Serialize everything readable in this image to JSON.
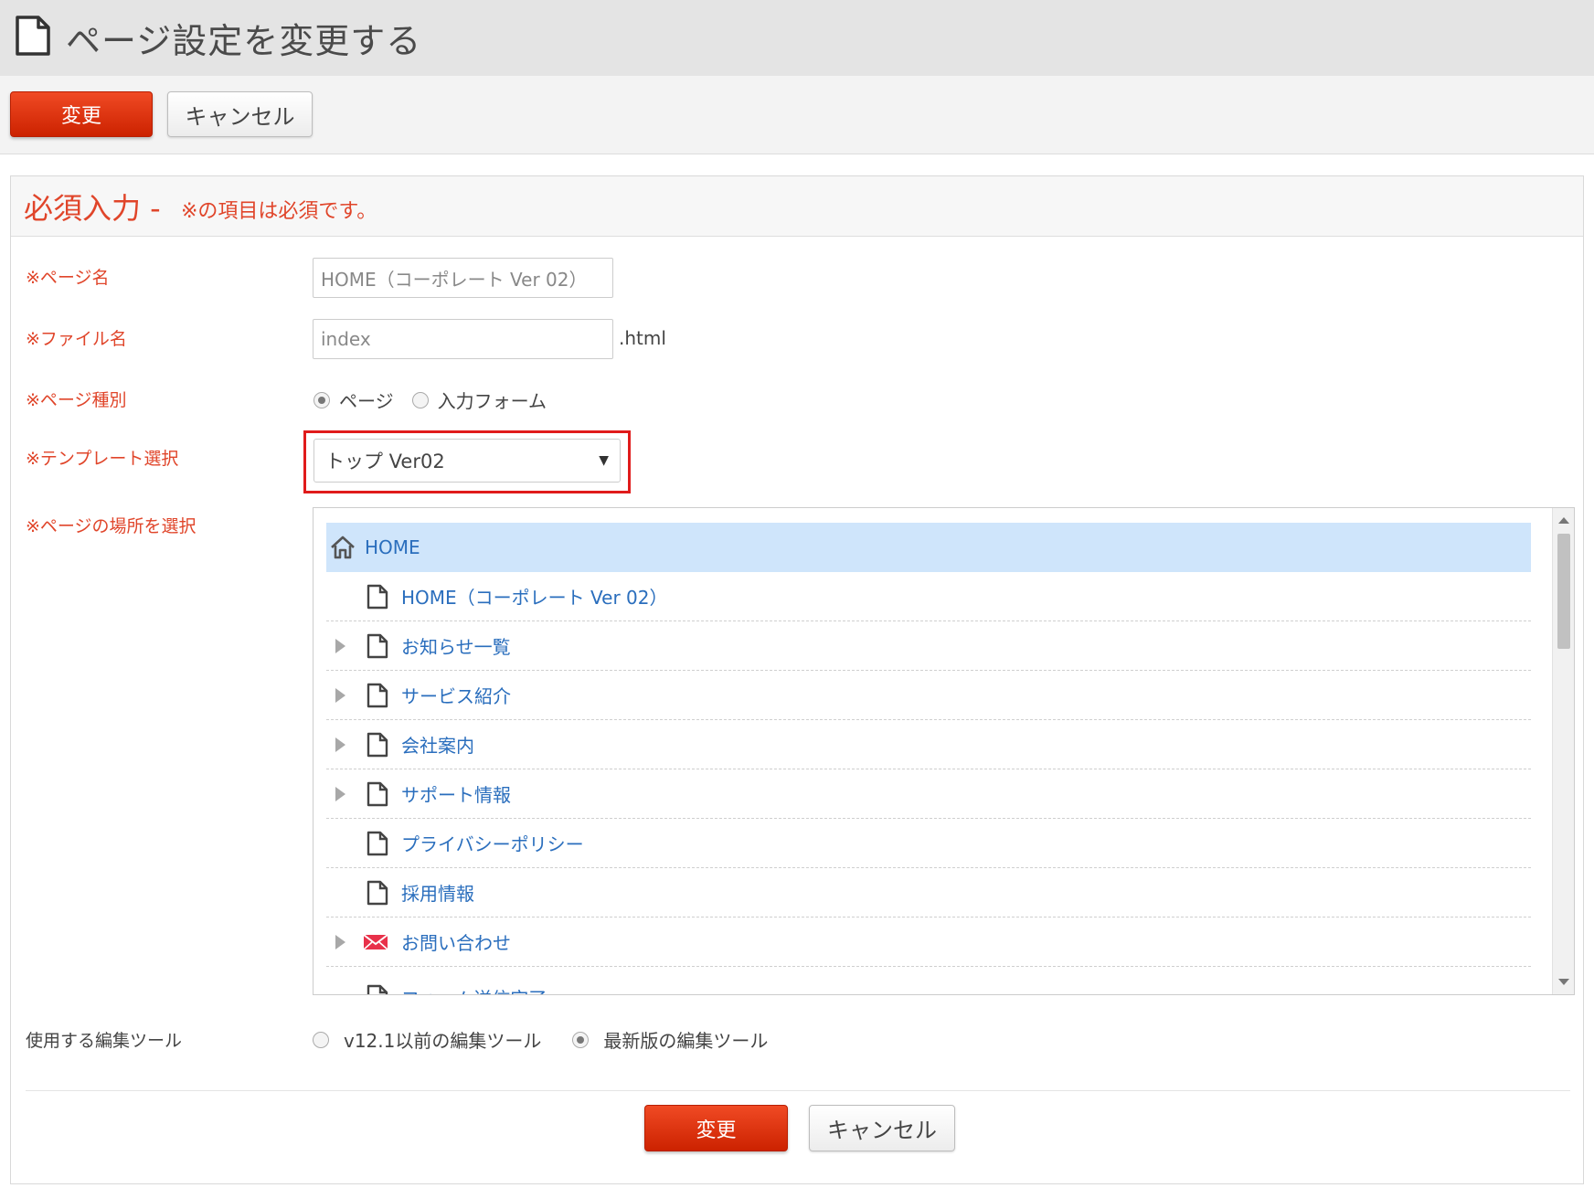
{
  "header": {
    "title": "ページ設定を変更する"
  },
  "toolbar": {
    "submit_label": "変更",
    "cancel_label": "キャンセル"
  },
  "section": {
    "title": "必須入力 -",
    "note": "※の項目は必須です。"
  },
  "form": {
    "page_name": {
      "label": "※ページ名",
      "value": "HOME（コーポレート Ver 02）"
    },
    "file_name": {
      "label": "※ファイル名",
      "value": "index",
      "suffix": ".html"
    },
    "page_type": {
      "label": "※ページ種別",
      "options": [
        "ページ",
        "入力フォーム"
      ],
      "selected": "ページ"
    },
    "template": {
      "label": "※テンプレート選択",
      "value": "トップ Ver02"
    },
    "location": {
      "label": "※ページの場所を選択"
    },
    "editor": {
      "label": "使用する編集ツール",
      "options": [
        "v12.1以前の編集ツール",
        "最新版の編集ツール"
      ],
      "selected": "最新版の編集ツール"
    }
  },
  "tree": {
    "items": [
      {
        "label": "HOME",
        "icon": "home-icon",
        "expandable": false,
        "selected": true
      },
      {
        "label": "HOME（コーポレート Ver 02）",
        "icon": "page-icon",
        "expandable": false
      },
      {
        "label": "お知らせ一覧",
        "icon": "page-icon",
        "expandable": true
      },
      {
        "label": "サービス紹介",
        "icon": "page-icon",
        "expandable": true
      },
      {
        "label": "会社案内",
        "icon": "page-icon",
        "expandable": true
      },
      {
        "label": "サポート情報",
        "icon": "page-icon",
        "expandable": true
      },
      {
        "label": "プライバシーポリシー",
        "icon": "page-icon",
        "expandable": false
      },
      {
        "label": "採用情報",
        "icon": "page-icon",
        "expandable": false
      },
      {
        "label": "お問い合わせ",
        "icon": "mail-icon",
        "expandable": true
      },
      {
        "label": "フォーム送信完了",
        "icon": "page-icon",
        "expandable": false
      }
    ]
  },
  "footer": {
    "submit_label": "変更",
    "cancel_label": "キャンセル"
  },
  "colors": {
    "accent_red": "#e0452a",
    "primary_button": "#dd2a00",
    "link_blue": "#2a6ebd",
    "selected_row": "#cfe5fb",
    "highlight_border": "#e01b1b"
  }
}
